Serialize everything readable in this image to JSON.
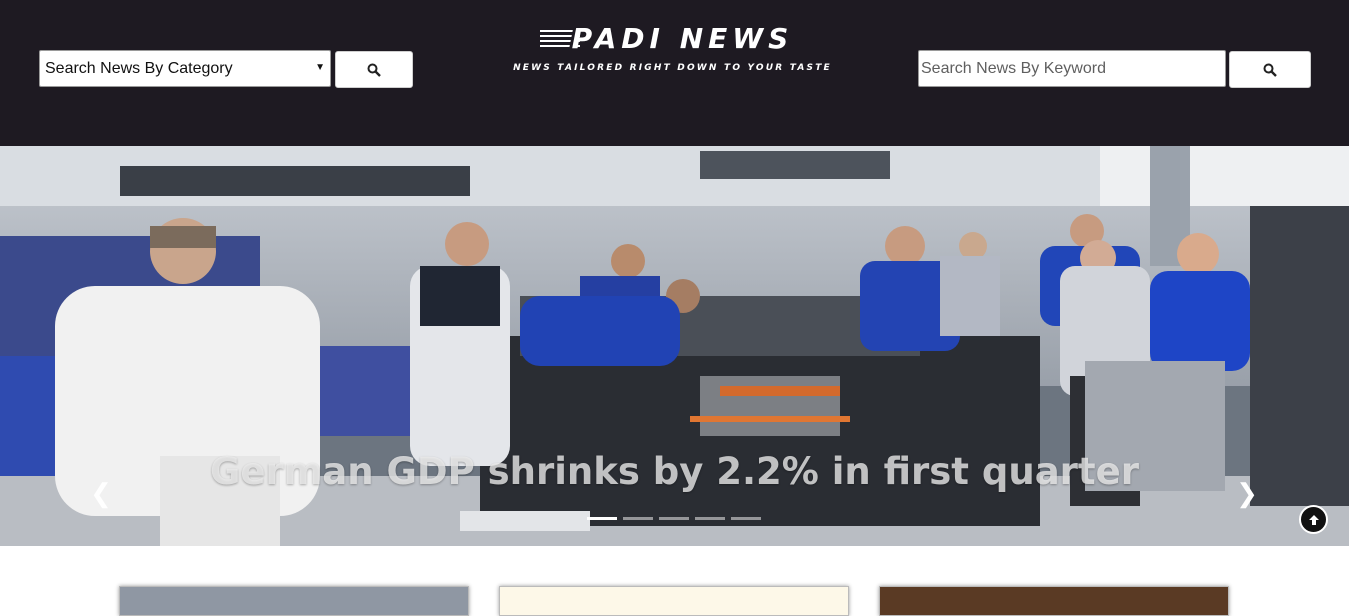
{
  "header": {
    "brand_title": "PADI NEWS",
    "brand_tagline": "News Tailored right down to your Taste",
    "category_select": {
      "selected": "Search News By Category"
    },
    "keyword_search": {
      "placeholder": "Search News By Keyword"
    },
    "search_button_icon": "search-icon"
  },
  "carousel": {
    "caption": "German GDP shrinks by 2.2% in first quarter",
    "slide_count": 5,
    "active_slide": 1,
    "prev_icon": "chevron-left-icon",
    "next_icon": "chevron-right-icon"
  },
  "controls": {
    "back_to_top_icon": "arrow-up-icon"
  }
}
